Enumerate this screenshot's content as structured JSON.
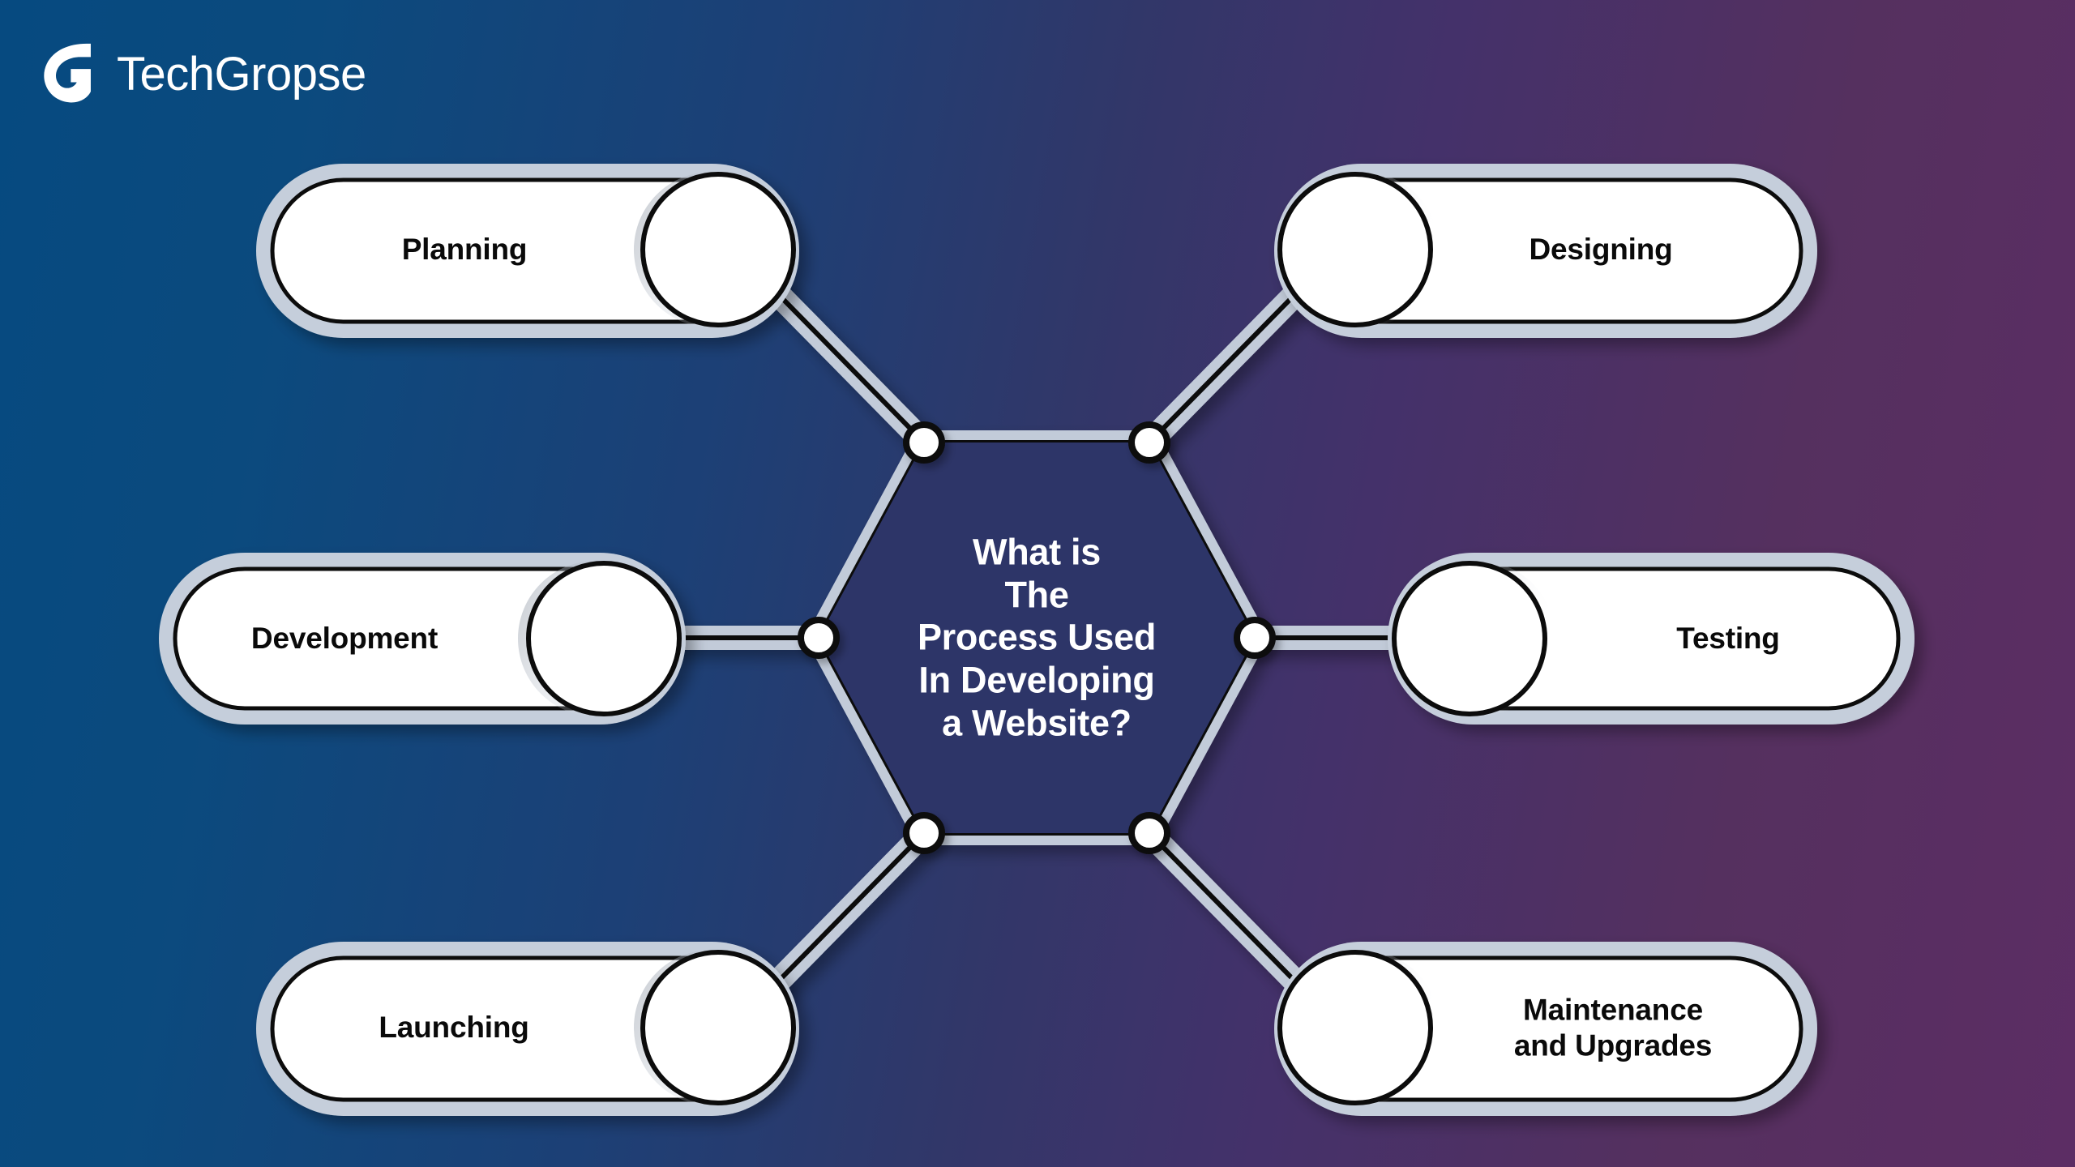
{
  "brand": {
    "logo_icon": "techgropse-g-mark-icon",
    "name": "TechGropse"
  },
  "center": {
    "title": "What is\nThe\nProcess Used\nIn Developing\na Website?",
    "shape": "hexagon",
    "fill_color": "#2d3568"
  },
  "colors": {
    "background_left": "#064a80",
    "background_mid": "#313769",
    "background_right": "#5c2d64",
    "connector_band": "#c2cbd9",
    "connector_line": "#000000",
    "node_fill": "#ffffff",
    "pill_outer": "#c5cedb",
    "pill_inner": "#ffffff",
    "pill_text": "#0a0a0a",
    "center_text": "#ffffff"
  },
  "nodes": [
    {
      "id": "planning",
      "label": "Planning",
      "side": "left",
      "row": "top",
      "icon": "empty-circle-icon"
    },
    {
      "id": "designing",
      "label": "Designing",
      "side": "right",
      "row": "top",
      "icon": "empty-circle-icon"
    },
    {
      "id": "development",
      "label": "Development",
      "side": "left",
      "row": "middle",
      "icon": "empty-circle-icon"
    },
    {
      "id": "testing",
      "label": "Testing",
      "side": "right",
      "row": "middle",
      "icon": "empty-circle-icon"
    },
    {
      "id": "launching",
      "label": "Launching",
      "side": "left",
      "row": "bottom",
      "icon": "empty-circle-icon"
    },
    {
      "id": "maintenance",
      "label": "Maintenance\nand Upgrades",
      "side": "right",
      "row": "bottom",
      "icon": "empty-circle-icon"
    }
  ]
}
